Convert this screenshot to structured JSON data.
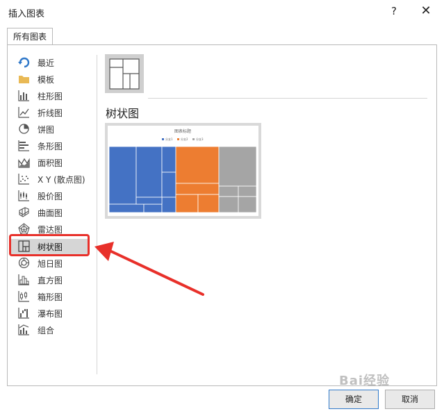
{
  "window": {
    "title": "插入图表",
    "help_label": "?",
    "close_label": "✕"
  },
  "tabs": [
    {
      "label": "所有图表"
    }
  ],
  "sidebar": {
    "items": [
      {
        "label": "最近",
        "icon": "recent-icon"
      },
      {
        "label": "模板",
        "icon": "folder-icon"
      },
      {
        "label": "柱形图",
        "icon": "column-chart-icon"
      },
      {
        "label": "折线图",
        "icon": "line-chart-icon"
      },
      {
        "label": "饼图",
        "icon": "pie-chart-icon"
      },
      {
        "label": "条形图",
        "icon": "bar-chart-icon"
      },
      {
        "label": "面积图",
        "icon": "area-chart-icon"
      },
      {
        "label": "X Y (散点图)",
        "icon": "scatter-chart-icon"
      },
      {
        "label": "股价图",
        "icon": "stock-chart-icon"
      },
      {
        "label": "曲面图",
        "icon": "surface-chart-icon"
      },
      {
        "label": "雷达图",
        "icon": "radar-chart-icon"
      },
      {
        "label": "树状图",
        "icon": "treemap-icon",
        "selected": true
      },
      {
        "label": "旭日图",
        "icon": "sunburst-icon"
      },
      {
        "label": "直方图",
        "icon": "histogram-icon"
      },
      {
        "label": "箱形图",
        "icon": "box-whisker-icon"
      },
      {
        "label": "瀑布图",
        "icon": "waterfall-icon"
      },
      {
        "label": "组合",
        "icon": "combo-chart-icon"
      }
    ]
  },
  "content": {
    "chart_type_title": "树状图",
    "preview": {
      "title": "图表标题",
      "legend": [
        "分支1",
        "分支2",
        "分支3"
      ],
      "colors": {
        "branch1": "#4472c4",
        "branch2": "#ed7d31",
        "branch3": "#a5a5a5"
      }
    }
  },
  "buttons": {
    "ok": "确定",
    "cancel": "取消"
  },
  "watermark": "Bai经验",
  "colors": {
    "highlight": "#e8302a",
    "selected_bg": "#d6d6d6"
  }
}
